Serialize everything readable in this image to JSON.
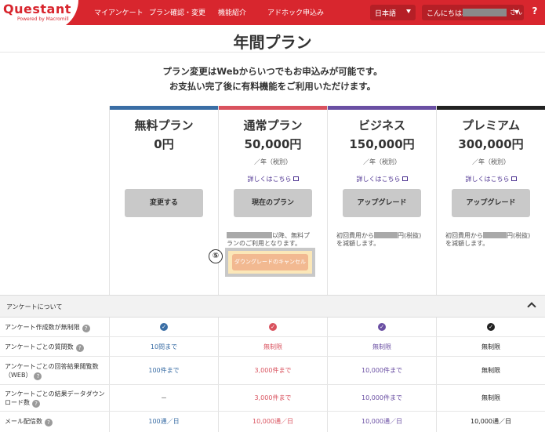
{
  "header": {
    "logo": "Questant",
    "logo_sub": "Powered by Macromill",
    "nav": [
      "マイアンケート",
      "プラン確認・変更",
      "機能紹介",
      "アドホック申込み"
    ],
    "language": "日本語",
    "greeting": "こんにちは、",
    "greeting_suffix": "さん",
    "help": "?"
  },
  "page": {
    "title": "年間プラン",
    "intro_line1": "プラン変更はWebからいつでもお申込みが可能です。",
    "intro_line2": "お支払い完了後に有料機能をご利用いただけます。"
  },
  "plans": [
    {
      "name": "無料プラン",
      "price": "0円",
      "unit": "",
      "link": "",
      "button": "変更する",
      "color": "#3a6ea5"
    },
    {
      "name": "通常プラン",
      "price": "50,000円",
      "unit": "／年（税別）",
      "link": "詳しくはこちら",
      "button": "現在のプラン",
      "color": "#d9525e",
      "note_a": "以降、無料プ",
      "note_b": "ランのご利用となります。"
    },
    {
      "name": "ビジネス",
      "price": "150,000円",
      "unit": "／年（税別）",
      "link": "詳しくはこちら",
      "button": "アップグレード",
      "color": "#6a4fa3",
      "note_a": "初回費用から",
      "note_a2": "円(税抜)",
      "note_b": "を減額します。"
    },
    {
      "name": "プレミアム",
      "price": "300,000円",
      "unit": "／年（税別）",
      "link": "詳しくはこちら",
      "button": "アップグレード",
      "color": "#222222",
      "note_a": "初回費用から",
      "note_a2": "円(税抜)",
      "note_b": "を減額します。"
    }
  ],
  "downgrade": {
    "marker": "⑤",
    "button": "ダウングレードのキャンセル"
  },
  "section": {
    "title": "アンケートについて"
  },
  "features": [
    {
      "label": "アンケート作成数が無制限",
      "values": [
        "✓",
        "✓",
        "✓",
        "✓"
      ]
    },
    {
      "label": "アンケートごとの質問数",
      "values": [
        "10問まで",
        "無制限",
        "無制限",
        "無制限"
      ]
    },
    {
      "label": "アンケートごとの回答結果閲覧数（WEB）",
      "values": [
        "100件まで",
        "3,000件まで",
        "10,000件まで",
        "無制限"
      ]
    },
    {
      "label": "アンケートごとの結果データダウンロード数",
      "values": [
        "－",
        "3,000件まで",
        "10,000件まで",
        "無制限"
      ]
    },
    {
      "label": "メール配信数",
      "values": [
        "100通／日",
        "10,000通／日",
        "10,000通／日",
        "10,000通／日"
      ]
    }
  ],
  "colors": {
    "brand": "#d8262e",
    "free": "#3a6ea5",
    "standard": "#d9525e",
    "business": "#6a4fa3",
    "premium": "#222222"
  }
}
